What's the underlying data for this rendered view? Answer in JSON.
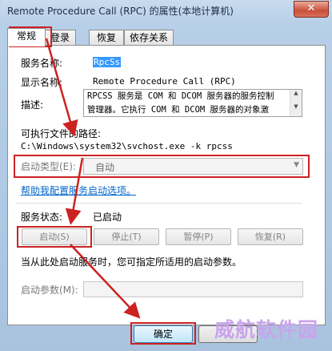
{
  "window": {
    "title": "Remote Procedure Call (RPC) 的属性(本地计算机)",
    "close_symbol": "✕"
  },
  "tabs": [
    {
      "label": "常规",
      "active": true
    },
    {
      "label": "登录",
      "active": false
    },
    {
      "label": "恢复",
      "active": false
    },
    {
      "label": "依存关系",
      "active": false
    }
  ],
  "general": {
    "service_name_label": "服务名称:",
    "service_name_value": "RpcSs",
    "display_name_label": "显示名称:",
    "display_name_value": "Remote Procedure Call (RPC)",
    "description_label": "描述:",
    "description_lines": [
      "RPCSS 服务是 COM 和 DCOM 服务器的服务控制",
      "管理器。它执行 COM 和 DCOM 服务器的对象激"
    ],
    "exe_path_label": "可执行文件的路径:",
    "exe_path_value": "C:\\Windows\\system32\\svchost.exe -k rpcss",
    "startup_type_label": "启动类型(E):",
    "startup_type_value": "自动",
    "help_link": "帮助我配置服务启动选项。",
    "status_label": "服务状态:",
    "status_value": "已启动",
    "buttons": {
      "start": "启动(S)",
      "stop": "停止(T)",
      "pause": "暂停(P)",
      "resume": "恢复(R)"
    },
    "hint_text": "当从此处启动服务时，您可指定所适用的启动参数。",
    "start_params_label": "启动参数(M):",
    "start_params_value": ""
  },
  "footer": {
    "ok_label": "确定"
  },
  "watermark": "威航软件园",
  "annotation_color": "#cc2222"
}
